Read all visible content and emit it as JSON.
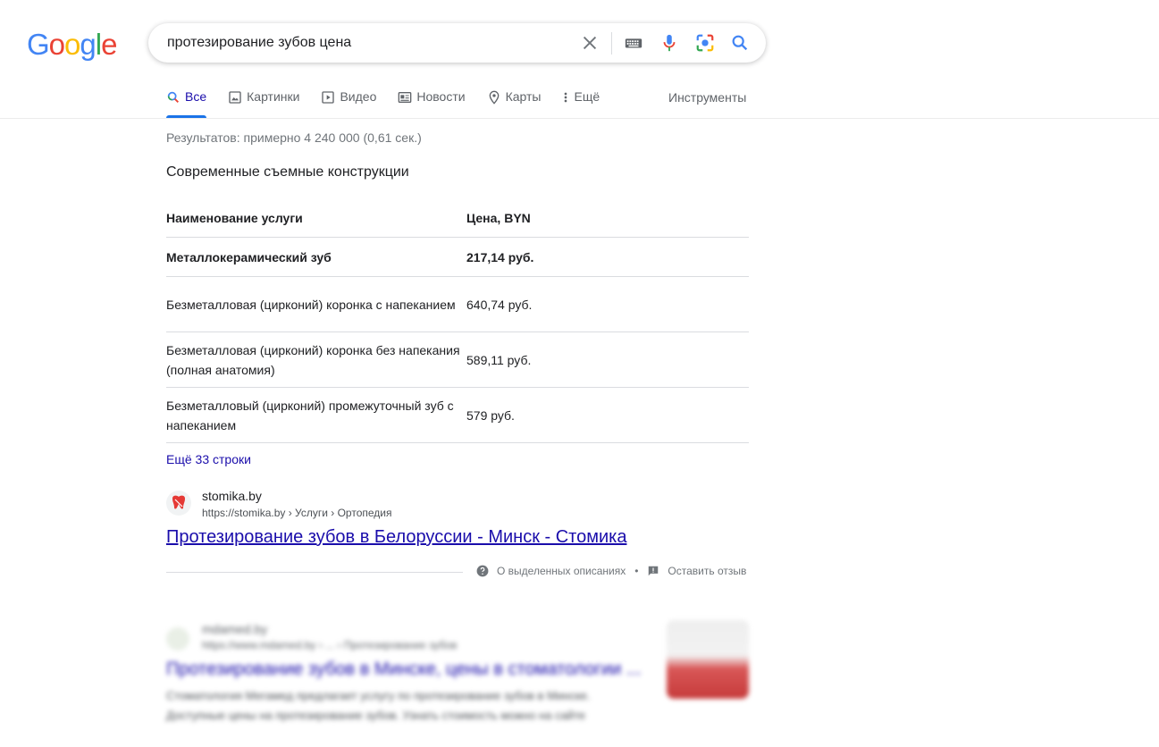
{
  "logo": {
    "letters": [
      "G",
      "o",
      "o",
      "g",
      "l",
      "e"
    ]
  },
  "search": {
    "query": "протезирование зубов цена"
  },
  "tabs": [
    {
      "label": "Все"
    },
    {
      "label": "Картинки"
    },
    {
      "label": "Видео"
    },
    {
      "label": "Новости"
    },
    {
      "label": "Карты"
    },
    {
      "label": "Ещё"
    }
  ],
  "tools_label": "Инструменты",
  "stats": "Результатов: примерно 4 240 000 (0,61 сек.)",
  "snippet": {
    "title": "Современные съемные конструкции",
    "header": {
      "name": "Наименование услуги",
      "price": "Цена, BYN"
    },
    "rows": [
      {
        "name": "Металлокерамический зуб",
        "price": "217,14 руб."
      },
      {
        "name": "Безметалловая (цирконий) коронка с напеканием",
        "price": "640,74 руб."
      },
      {
        "name": "Безметалловая (цирконий) коронка без напекания (полная анатомия)",
        "price": "589,11 руб."
      },
      {
        "name": "Безметалловый (цирконий) промежуточный зуб с напеканием",
        "price": "579 руб."
      }
    ],
    "more_rows": "Ещё 33 строки"
  },
  "result": {
    "site_name": "stomika.by",
    "url": "https://stomika.by › Услуги › Ортопедия",
    "title": "Протезирование зубов в Белоруссии - Минск - Стомика"
  },
  "feedback": {
    "about": "О выделенных описаниях",
    "separator": "•",
    "leave_feedback": "Оставить отзыв"
  },
  "blurred_result": {
    "site_name": "mdamed.by",
    "url": "https://www.mdamed.by › ... › Протезирование зубов",
    "title": "Протезирование зубов в Минске, цены в стоматологии ...",
    "desc": "Стоматология Мегамед предлагает услугу по протезирование зубов в Минске. Доступные цены на протезирование зубов. Узнать стоимость можно на сайте"
  },
  "colors": {
    "link": "#1a0dab",
    "accent": "#1a73e8",
    "g_blue": "#4285f4",
    "g_red": "#ea4335",
    "g_yellow": "#fbbc05",
    "g_green": "#34a853"
  }
}
